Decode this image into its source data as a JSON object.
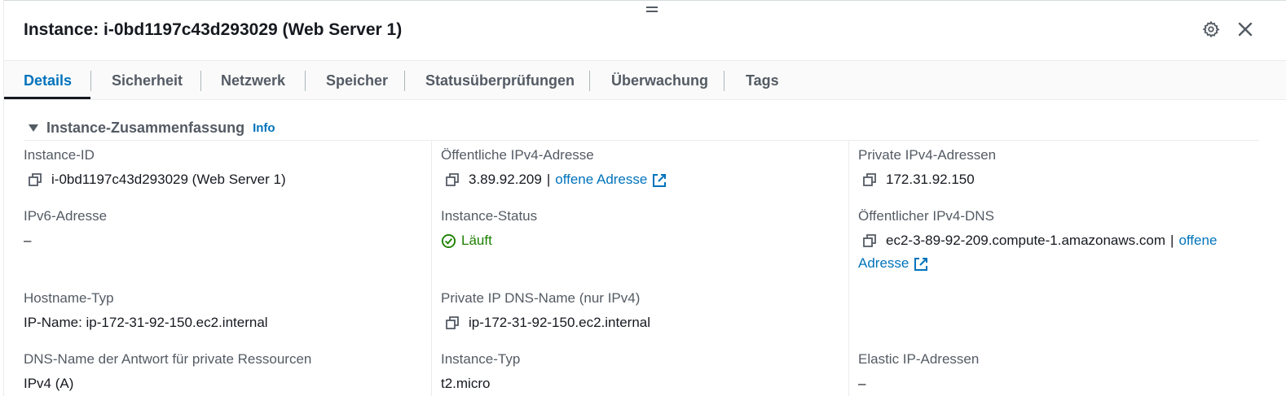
{
  "panel": {
    "title": "Instance: i-0bd1197c43d293029 (Web Server 1)"
  },
  "tabs": [
    {
      "label": "Details"
    },
    {
      "label": "Sicherheit"
    },
    {
      "label": "Netzwerk"
    },
    {
      "label": "Speicher"
    },
    {
      "label": "Statusüberprüfungen"
    },
    {
      "label": "Überwachung"
    },
    {
      "label": "Tags"
    }
  ],
  "active_tab": "Details",
  "section": {
    "title": "Instance-Zusammenfassung",
    "info": "Info"
  },
  "fields": {
    "instance_id": {
      "label": "Instance-ID",
      "value": "i-0bd1197c43d293029 (Web Server 1)"
    },
    "public_ipv4": {
      "label": "Öffentliche IPv4-Adresse",
      "value": "3.89.92.209",
      "separator": "|",
      "link": "offene Adresse"
    },
    "private_ipv4": {
      "label": "Private IPv4-Adressen",
      "value": "172.31.92.150"
    },
    "ipv6": {
      "label": "IPv6-Adresse",
      "value": "–"
    },
    "instance_status": {
      "label": "Instance-Status",
      "value": "Läuft",
      "color": "#1d8102"
    },
    "public_dns": {
      "label": "Öffentlicher IPv4-DNS",
      "value": "ec2-3-89-92-209.compute-1.amazonaws.com",
      "separator": "|",
      "link_part1": "offene",
      "link_part2": "Adresse"
    },
    "hostname_type": {
      "label": "Hostname-Typ",
      "value": "IP-Name: ip-172-31-92-150.ec2.internal"
    },
    "private_dns": {
      "label": "Private IP DNS-Name (nur IPv4)",
      "value": "ip-172-31-92-150.ec2.internal"
    },
    "dns_answer": {
      "label": "DNS-Name der Antwort für private Ressourcen",
      "value": "IPv4 (A)"
    },
    "instance_type": {
      "label": "Instance-Typ",
      "value": "t2.micro"
    },
    "elastic_ip": {
      "label": "Elastic IP-Adressen",
      "value": "–"
    }
  },
  "colors": {
    "link": "#0073bb",
    "text": "#16191f",
    "label": "#545b64",
    "success": "#1d8102"
  },
  "icons": [
    "drag-handle-icon",
    "gear-icon",
    "close-icon",
    "caret-down-icon",
    "copy-icon",
    "external-link-icon",
    "check-circle-icon"
  ]
}
